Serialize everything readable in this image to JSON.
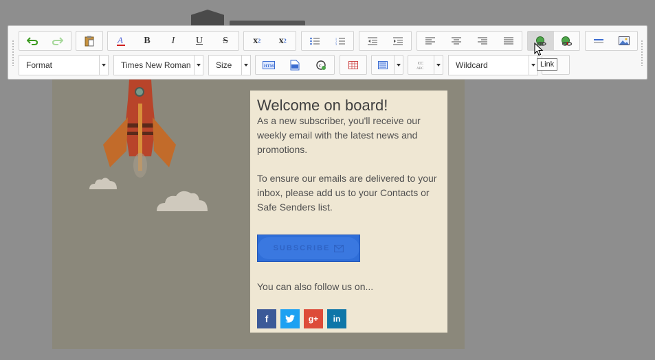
{
  "toolbar": {
    "format_label": "Format",
    "font_label": "Times New Roman",
    "size_label": "Size",
    "wildcard_label": "Wildcard",
    "tooltip": "Link",
    "buttons": {
      "bold": "B",
      "italic": "I",
      "underline": "U",
      "strike": "S",
      "subscript": "x",
      "superscript": "x"
    }
  },
  "card": {
    "title": "Welcome on board!",
    "para1": "As a new subscriber, you'll receive our weekly email with the latest news and promotions.",
    "para2": "To ensure our emails are delivered to your inbox, please add us to your Contacts or Safe Senders list.",
    "subscribe": "SUBSCRIBE",
    "follow": "You can also follow us on...",
    "social": {
      "facebook": "f",
      "google": "g+",
      "linkedin": "in"
    }
  },
  "colors": {
    "accent": "#2f6ed8",
    "facebook": "#3b5998",
    "twitter": "#1da1f2",
    "google": "#dd4b39",
    "linkedin": "#0e76a8"
  }
}
